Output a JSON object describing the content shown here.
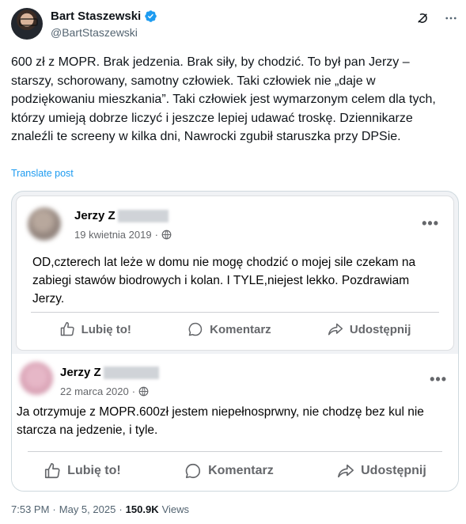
{
  "author": {
    "display_name": "Bart Staszewski",
    "handle": "@BartStaszewski",
    "verified_color": "#1d9bf0"
  },
  "header_icons": [
    "grok-icon",
    "more-options-icon"
  ],
  "tweet": {
    "text": "600 zł z MOPR. Brak jedzenia. Brak siły, by chodzić. To był pan Jerzy – starszy, schorowany, samotny człowiek. Taki człowiek nie „daje w podziękowaniu mieszkania”. Taki człowiek jest wymarzonym celem dla tych, którzy umieją dobrze liczyć i jeszcze lepiej udawać troskę. Dziennikarze znaleźli te screeny w kilka dni, Nawrocki zgubił staruszka przy DPSie.",
    "translate_label": "Translate post"
  },
  "media": {
    "posts": [
      {
        "name": "Jerzy Z",
        "date": "19 kwietnia 2019",
        "body": "OD,czterech lat leże w domu nie mogę chodzić o mojej sile czekam na zabiegi stawów biodrowych i kolan. I TYLE,niejest lekko. Pozdrawiam Jerzy.",
        "actions": {
          "like": "Lubię to!",
          "comment": "Komentarz",
          "share": "Udostępnij"
        }
      },
      {
        "name": "Jerzy Z",
        "date": "22 marca 2020",
        "body": "Ja otrzymuje z MOPR.600zł jestem niepełnosprwny, nie chodzę bez kul nie starcza na jedzenie, i tyle.",
        "actions": {
          "like": "Lubię to!",
          "comment": "Komentarz",
          "share": "Udostępnij"
        }
      }
    ]
  },
  "footer": {
    "time": "7:53 PM",
    "separator": "·",
    "date": "May 5, 2025",
    "separator2": "·",
    "views_count": "150.9K",
    "views_label": "Views"
  }
}
